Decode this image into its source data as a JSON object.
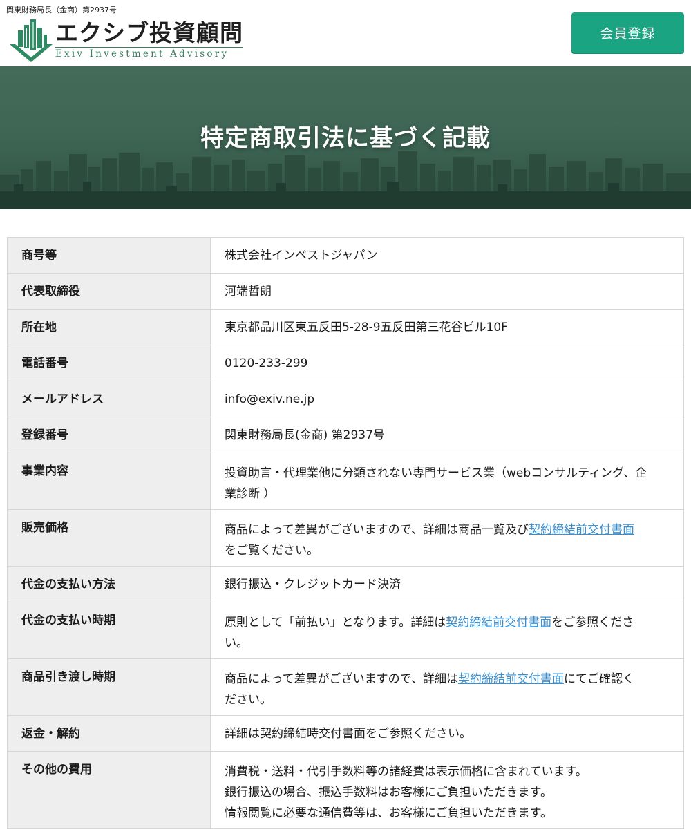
{
  "header": {
    "registration_note": "関東財務局長（金商）第2937号",
    "logo_jp": "エクシブ投資顧問",
    "logo_en": "Exiv Investment Advisory",
    "register_button": "会員登録"
  },
  "hero": {
    "title": "特定商取引法に基づく記載"
  },
  "table": {
    "rows": [
      {
        "label": "商号等",
        "value": "株式会社インベストジャパン"
      },
      {
        "label": "代表取締役",
        "value": "河端哲朗"
      },
      {
        "label": "所在地",
        "value": "東京都品川区東五反田5-28-9五反田第三花谷ビル10F"
      },
      {
        "label": "電話番号",
        "value": "0120-233-299"
      },
      {
        "label": "メールアドレス",
        "value": "info@exiv.ne.jp"
      },
      {
        "label": "登録番号",
        "value": "関東財務局長(金商) 第2937号"
      },
      {
        "label": "事業内容",
        "value_line1": "投資助言・代理業他に分類されない専門サービス業（webコンサルティング、企",
        "value_line2": "業診断 ）"
      },
      {
        "label": "販売価格",
        "value_before": "商品によって差異がございますので、詳細は商品一覧及び",
        "link": "契約締結前交付書面",
        "value_after": "をご覧ください。"
      },
      {
        "label": "代金の支払い方法",
        "value": "銀行振込・クレジットカード決済"
      },
      {
        "label": "代金の支払い時期",
        "value_before": "原則として「前払い」となります。詳細は",
        "link": "契約締結前交付書面",
        "value_after": "をご参照くださ",
        "value_line2": "い。"
      },
      {
        "label": "商品引き渡し時期",
        "value_before": "商品によって差異がございますので、詳細は",
        "link": "契約締結前交付書面",
        "value_after": "にてご確認く",
        "value_line2": "ださい。"
      },
      {
        "label": "返金・解約",
        "value": "詳細は契約締結時交付書面をご参照ください。"
      },
      {
        "label": "その他の費用",
        "lines": [
          "消費税・送料・代引手数料等の諸経費は表示価格に含まれています。",
          "銀行振込の場合、振込手数料はお客様にご負担いただきます。",
          "情報閲覧に必要な通信費等は、お客様にご負担いただきます。"
        ]
      }
    ]
  },
  "colors": {
    "accent": "#1aa482",
    "hero_green": "#3f6655",
    "link": "#3a8fcf",
    "label_bg": "#eeeeee"
  }
}
